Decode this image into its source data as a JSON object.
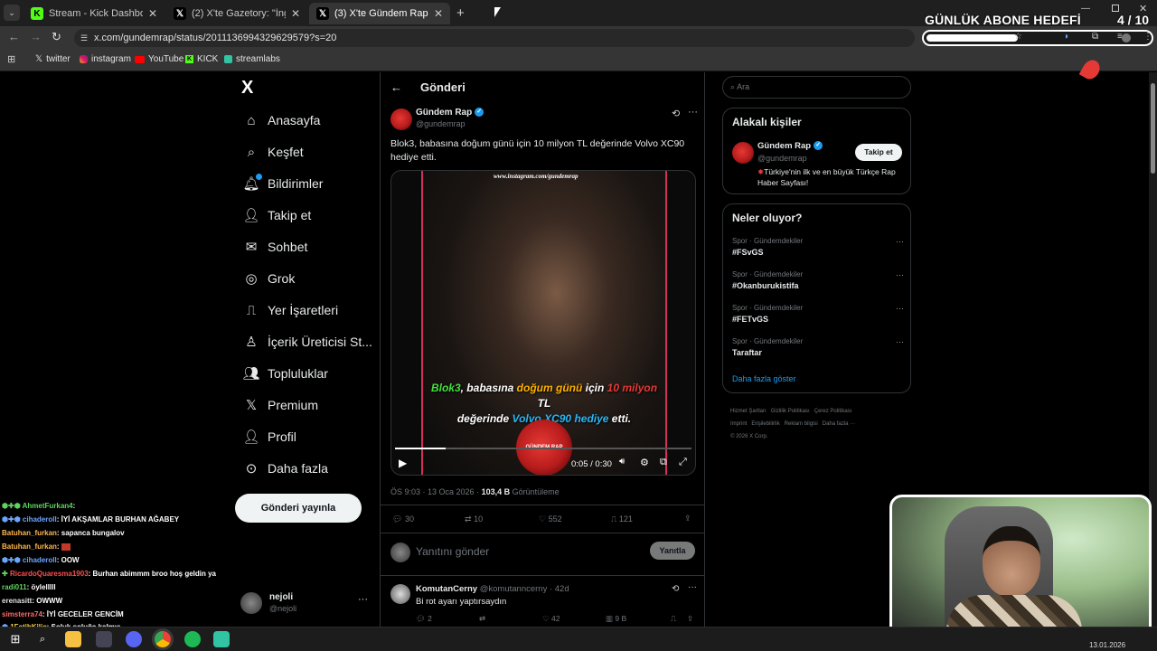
{
  "browser": {
    "tabs": [
      {
        "title": "Stream - Kick Dashboard",
        "icon": "kick-icon"
      },
      {
        "title": "(2) X'te Gazetory: \"İngiltere'den",
        "icon": "x-icon"
      },
      {
        "title": "(3) X'te Gündem Rap: \"Blok3, b",
        "icon": "x-icon"
      }
    ],
    "url": "x.com/gundemrap/status/2011136994329629579?s=20",
    "bookmarks": [
      "twitter",
      "instagram",
      "YouTube",
      "KICK",
      "streamlabs"
    ]
  },
  "overlay": {
    "goal_title": "GÜNLÜK ABONE HEDEFİ",
    "goal_count": "4 / 10",
    "goal_progress": 0.4
  },
  "sidebar": {
    "logo": "X",
    "items": [
      "Anasayfa",
      "Keşfet",
      "Bildirimler",
      "Takip et",
      "Sohbet",
      "Grok",
      "Yer İşaretleri",
      "İçerik Üreticisi St...",
      "Topluluklar",
      "Premium",
      "Profil",
      "Daha fazla"
    ],
    "post_button": "Gönderi yayınla",
    "user_name": "nejoli",
    "user_handle": "@nejoli"
  },
  "post": {
    "header": "Gönderi",
    "author": "Gündem Rap",
    "handle": "@gundemrap",
    "text": "Blok3, babasına doğum günü için 10 milyon TL değerinde Volvo XC90 hediye etti.",
    "video_watermark": "www.instagram.com/gundemrap",
    "caption_part1": "Blok3",
    "caption_part2": ", babasına ",
    "caption_part3": "doğum günü",
    "caption_part4": " için ",
    "caption_part5": "10 milyon",
    "caption_part6": " TL",
    "caption_line2_a": "değerinde ",
    "caption_line2_b": "Volvo XC90 hediye",
    "caption_line2_c": " etti.",
    "logo_text": "GÜNDEM RAP",
    "video_time": "0:05 / 0:30",
    "video_progress": 0.17,
    "timestamp": "ÖS 9:03 · 13 Oca 2026 · ",
    "views_count": "103,4 B",
    "views_label": " Görüntüleme",
    "replies": "30",
    "reposts": "10",
    "likes": "552",
    "bookmarks": "121",
    "reply_placeholder": "Yanıtını gönder",
    "reply_button": "Yanıtla"
  },
  "reply": {
    "author": "KomutanCerny",
    "handle": "@komutanncerny · 42d",
    "text": "Bi rot ayarı yaptırsaydın",
    "replies": "2",
    "likes": "42",
    "views": "9 B"
  },
  "right": {
    "search_placeholder": "Ara",
    "related_title": "Alakalı kişiler",
    "related_name": "Gündem Rap",
    "related_handle": "@gundemrap",
    "related_bio": "Türkiye'nin ilk ve en büyük Türkçe Rap Haber Sayfası!",
    "follow_button": "Takip et",
    "trends_title": "Neler oluyor?",
    "trends": [
      {
        "category": "Spor · Gündemdekiler",
        "name": "#FSvGS"
      },
      {
        "category": "Spor · Gündemdekiler",
        "name": "#Okanburukistifa"
      },
      {
        "category": "Spor · Gündemdekiler",
        "name": "#FETvGS"
      },
      {
        "category": "Spor · Gündemdekiler",
        "name": "Taraftar"
      }
    ],
    "show_more": "Daha fazla göster",
    "footer_line1": [
      "Hizmet Şartları",
      "Gizlilik Politikası",
      "Çerez Politikası"
    ],
    "footer_line2": [
      "Imprint",
      "Erişilebilirlik",
      "Reklam bilgisi",
      "Daha fazla ···"
    ],
    "copyright": "© 2026 X Corp."
  },
  "chat": [
    {
      "user": "AhmetFurkan4",
      "msg": ": ",
      "color": "#5fd35f"
    },
    {
      "user": "cihaderoll",
      "msg": ": İYİ AKŞAMLAR BURHAN AĞABEY",
      "color": "#6aa5ff"
    },
    {
      "user": "Batuhan_furkan",
      "msg": ": sapanca bungalov",
      "color": "#ffb84d"
    },
    {
      "user": "Batuhan_furkan",
      "msg": ": ",
      "color": "#ffb84d"
    },
    {
      "user": "cihaderoll",
      "msg": ": OOW",
      "color": "#6aa5ff"
    },
    {
      "user": "RicardoQuaresma1903",
      "msg": ": Burhan abimmm broo hoş geldin ya",
      "color": "#ff4d4d"
    },
    {
      "user": "radi011",
      "msg": ": öylelllll",
      "color": "#5fd35f"
    },
    {
      "user": "erenasitt",
      "msg": ": OWWW",
      "color": "#e0e0e0"
    },
    {
      "user": "simsterra74",
      "msg": ": İYİ GECELER GENCİM",
      "color": "#ff6a6a"
    },
    {
      "user": "1FatihKilic",
      "msg": ": Soluk soluğa kalmış",
      "color": "#ffd54d"
    }
  ],
  "taskbar": {
    "date": "13.01.2026"
  }
}
